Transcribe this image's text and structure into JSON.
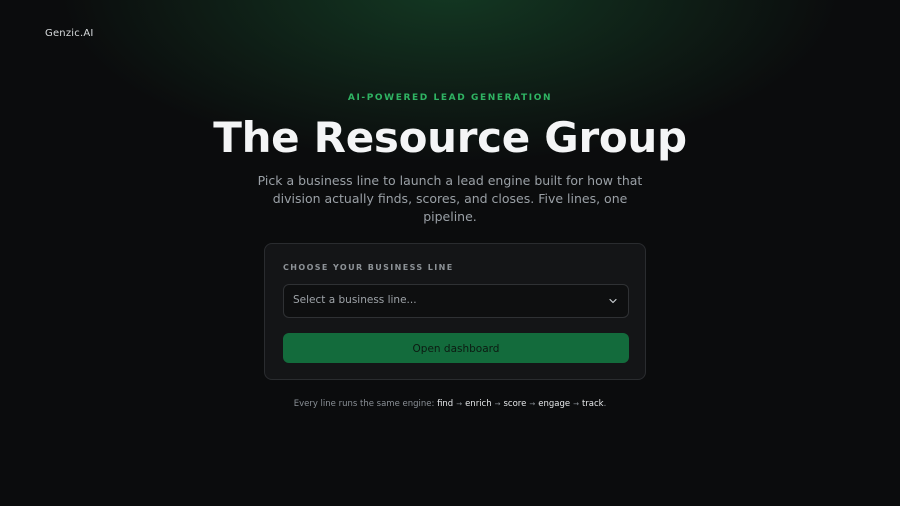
{
  "brand": {
    "name": "Genzic.AI"
  },
  "hero": {
    "eyebrow": "AI-POWERED LEAD GENERATION",
    "title": "The Resource Group",
    "subtitle": "Pick a business line to launch a lead engine built for how that division actually finds, scores, and closes. Five lines, one pipeline."
  },
  "form": {
    "label": "CHOOSE YOUR BUSINESS LINE",
    "select": {
      "placeholder": "Select a business line...",
      "icon": "chevron-down-icon"
    },
    "button_label": "Open dashboard"
  },
  "footnote": {
    "prefix": "Every line runs the same engine:",
    "steps": [
      "find",
      "enrich",
      "score",
      "engage",
      "track"
    ],
    "arrow": "→",
    "suffix": "."
  },
  "colors": {
    "accent": "#2fb463",
    "button": "#136b3c",
    "background": "#0b0c0d",
    "card": "#141517"
  }
}
